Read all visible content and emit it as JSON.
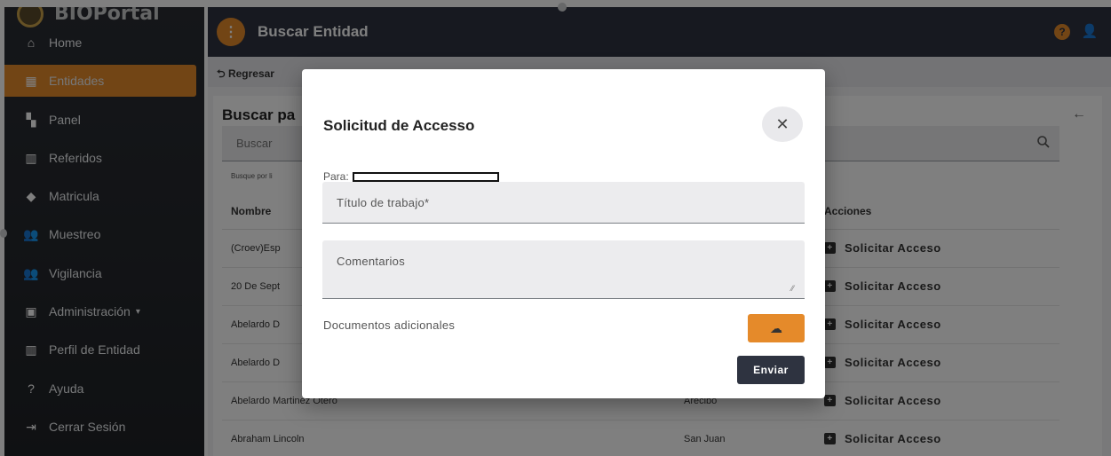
{
  "brand": {
    "text": "BIOPortal"
  },
  "sidebar": {
    "items": [
      {
        "label": "Home",
        "icon": "home-icon",
        "glyph": "⌂"
      },
      {
        "label": "Entidades",
        "icon": "building-icon",
        "glyph": "▦",
        "active": true
      },
      {
        "label": "Panel",
        "icon": "dashboard-icon",
        "glyph": "▚"
      },
      {
        "label": "Referidos",
        "icon": "city-icon",
        "glyph": "▥"
      },
      {
        "label": "Matricula",
        "icon": "graduation-cap-icon",
        "glyph": "◆"
      },
      {
        "label": "Muestreo",
        "icon": "people-icon",
        "glyph": "👥"
      },
      {
        "label": "Vigilancia",
        "icon": "people-icon",
        "glyph": "👥"
      },
      {
        "label": "Administración",
        "icon": "settings-box-icon",
        "glyph": "▣",
        "caret": "▾"
      },
      {
        "label": "Perfil de Entidad",
        "icon": "city-icon",
        "glyph": "▥"
      },
      {
        "label": "Ayuda",
        "icon": "help-circle-icon",
        "glyph": "?"
      },
      {
        "label": "Cerrar Sesión",
        "icon": "logout-icon",
        "glyph": "⇥"
      }
    ]
  },
  "appbar": {
    "title": "Buscar Entidad",
    "menu_glyph": "⋮",
    "help_glyph": "?",
    "user_glyph": "👤"
  },
  "content": {
    "back_label": "⮌ Regresar",
    "card_title": "Buscar pa",
    "card_back_glyph": "←",
    "search": {
      "label": "Buscar",
      "hint": "Busque por li"
    },
    "table": {
      "headers": {
        "name": "Nombre",
        "municipio": "",
        "actions": "Acciones"
      },
      "rows": [
        {
          "name": "(Croev)Esp",
          "municipio": "",
          "action": "Solicitar Acceso"
        },
        {
          "name": "20 De Sept",
          "municipio": "",
          "action": "Solicitar Acceso"
        },
        {
          "name": "Abelardo D",
          "municipio": "",
          "action": "Solicitar Acceso"
        },
        {
          "name": "Abelardo D",
          "municipio": "",
          "action": "Solicitar Acceso"
        },
        {
          "name": "Abelardo Martinez Otero",
          "municipio": "Arecibo",
          "action": "Solicitar Acceso"
        },
        {
          "name": "Abraham Lincoln",
          "municipio": "San Juan",
          "action": "Solicitar Acceso"
        }
      ]
    }
  },
  "modal": {
    "title": "Solicitud de Accesso",
    "close_glyph": "✕",
    "para_label": "Para:",
    "titulo_label": "Título de trabajo*",
    "comentarios_label": "Comentarios",
    "documentos_label": "Documentos adicionales",
    "upload_glyph": "☁",
    "send_label": "Enviar"
  },
  "colors": {
    "accent": "#e58a2a",
    "appbar": "#2e3340",
    "sidebar": "#26292e"
  }
}
